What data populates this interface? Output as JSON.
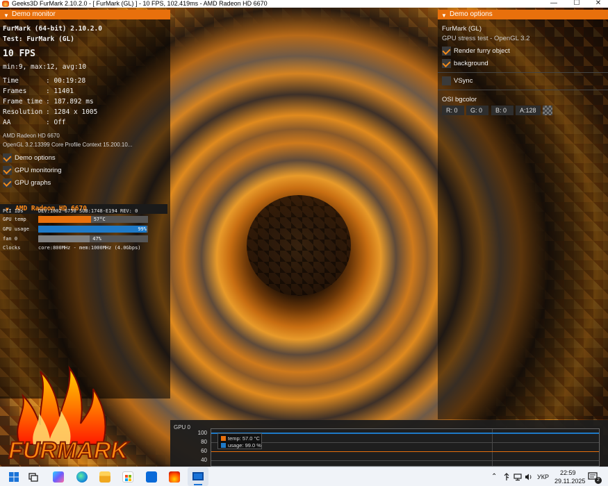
{
  "window": {
    "title": "Geeks3D FurMark 2.10.2.0 - [ FurMark (GL) ] - 10 FPS, 102.419ms - AMD Radeon HD 6670",
    "minimize": "—",
    "maximize": "☐",
    "close": "✕"
  },
  "monitor": {
    "header": "Demo monitor",
    "app_line": "FurMark (64-bit) 2.10.2.0",
    "test_line": "Test: FurMark (GL)",
    "fps": "10 FPS",
    "fps_stats": "min:9, max:12, avg:10",
    "stats": [
      {
        "label": "Time",
        "value": ": 00:19:28"
      },
      {
        "label": "Frames",
        "value": ": 11401"
      },
      {
        "label": "Frame time",
        "value": ": 187.892 ms"
      },
      {
        "label": "Resolution",
        "value": ": 1284 x 1005"
      },
      {
        "label": "AA",
        "value": ": Off"
      }
    ],
    "gpu_name": "AMD Radeon HD 6670",
    "gl_info": "OpenGL 3.2.13399 Core Profile Context 15.200.10...",
    "toggles": [
      {
        "label": "Demo options",
        "checked": true
      },
      {
        "label": "GPU monitoring",
        "checked": true
      },
      {
        "label": "GPU graphs",
        "checked": true
      }
    ]
  },
  "gpu_monitor": {
    "header": "AMD Radeon HD 6670",
    "pci_label": "PCI IDs",
    "pci_value": "DEV:1002-6758 SUB:1748-E194 REV: 0",
    "rows": [
      {
        "label": "GPU temp",
        "value_text": "57°C",
        "fraction": 0.48,
        "color": "#e8700c"
      },
      {
        "label": "GPU usage",
        "value_text": "99%",
        "fraction": 0.99,
        "color": "#1e7ac8"
      },
      {
        "label": "fan 0",
        "value_text": "47%",
        "fraction": 0.47,
        "color": "#808080"
      }
    ],
    "clocks_label": "Clocks",
    "clocks_value": "core:800MHz - mem:1000MHz (4.0Gbps)"
  },
  "logo": {
    "text": "FURMARK"
  },
  "options": {
    "header": "Demo options",
    "demo_name": "FurMark (GL)",
    "demo_desc": "GPU stress test - OpenGL 3.2",
    "checks": [
      {
        "label": "Render furry object",
        "checked": true
      },
      {
        "label": "background",
        "checked": true
      }
    ],
    "vsync": {
      "label": "VSync",
      "checked": false
    },
    "osi_label": "OSI bgcolor",
    "color_fields": [
      "R: 0",
      "G: 0",
      "B: 0",
      "A:128"
    ]
  },
  "graph": {
    "title": "GPU 0",
    "y_ticks": [
      "100",
      "80",
      "60",
      "40"
    ],
    "legend": [
      {
        "label": "temp: 57.0 °C",
        "color": "#e8700c"
      },
      {
        "label": "usage: 99.0 %",
        "color": "#1e7ac8"
      }
    ]
  },
  "taskbar": {
    "language": "УКР",
    "time": "22:59",
    "date": "29.11.2025",
    "notifications": "2"
  }
}
